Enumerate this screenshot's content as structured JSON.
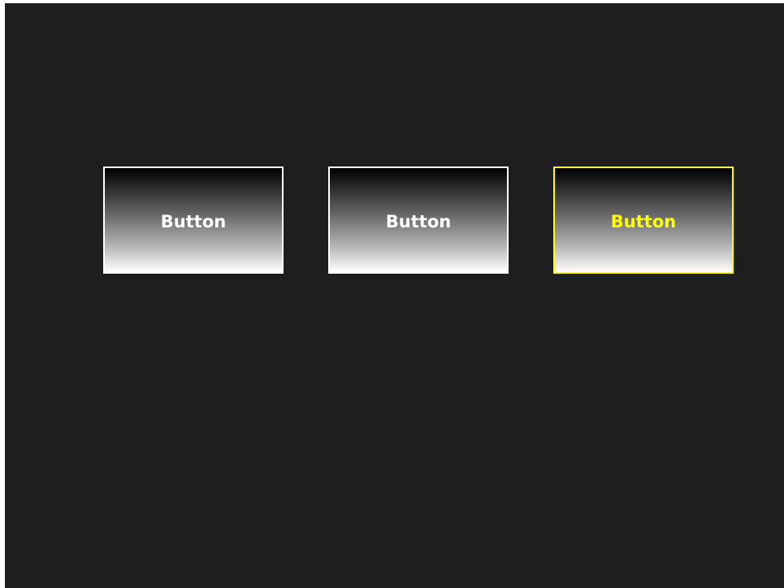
{
  "buttons": [
    {
      "label": "Button",
      "state": "normal"
    },
    {
      "label": "Button",
      "state": "normal"
    },
    {
      "label": "Button",
      "state": "focused"
    }
  ],
  "colors": {
    "background": "#1e1e1e",
    "button_border": "#ffffff",
    "button_text": "#ffffff",
    "focus_accent": "#ffff00"
  }
}
